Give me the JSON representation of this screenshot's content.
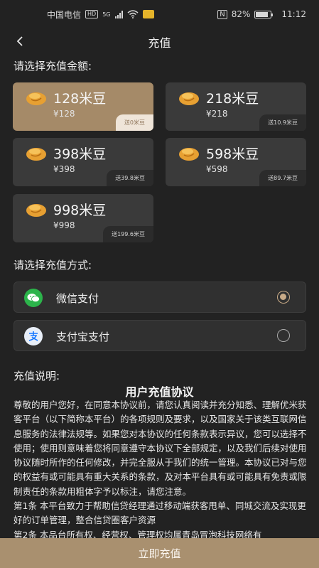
{
  "status_bar": {
    "carrier": "中国电信",
    "hd": "HD",
    "network": "5G",
    "nfc": "N",
    "battery": "82%",
    "time": "11:12"
  },
  "header": {
    "title": "充值",
    "back_icon": "chevron-left-icon"
  },
  "amount_section": {
    "label": "请选择充值金额:",
    "options": [
      {
        "title": "128米豆",
        "price": "¥128",
        "bonus": "送0米豆",
        "selected": true
      },
      {
        "title": "218米豆",
        "price": "¥218",
        "bonus": "送10.9米豆",
        "selected": false
      },
      {
        "title": "398米豆",
        "price": "¥398",
        "bonus": "送39.8米豆",
        "selected": false
      },
      {
        "title": "598米豆",
        "price": "¥598",
        "bonus": "送89.7米豆",
        "selected": false
      },
      {
        "title": "998米豆",
        "price": "¥998",
        "bonus": "送199.6米豆",
        "selected": false
      }
    ]
  },
  "payment_section": {
    "label": "请选择充值方式:",
    "methods": [
      {
        "label": "微信支付",
        "icon": "wechat-icon",
        "selected": true
      },
      {
        "label": "支付宝支付",
        "icon": "alipay-icon",
        "selected": false
      }
    ]
  },
  "description": {
    "label": "充值说明:",
    "agreement_title": "用户充值协议",
    "paragraphs": [
      "尊敬的用户您好，在同意本协议前，请您认真阅读并充分知悉、理解优米获客平台（以下简称本平台）的各项规则及要求，以及国家关于该类互联网信息服务的法律法规等。如果您对本协议的任何条款表示异议，您可以选择不使用；使用则意味着您将同意遵守本协议下全部规定，以及我们后续对使用协议随时所作的任何修改，并完全服从于我们的统一管理。本协议已对与您的权益有或可能具有重大关系的条款，及对本平台具有或可能具有免责或限制责任的条款用粗体字予以标注，请您注意。",
      "第1条 本平台致力于帮助信贷经理通过移动端获客甩单、同城交流及实现更好的订单管理，整合信贷圈客户资源",
      "第2条 本品台所有权、经营权、管理权均属青岛冒泡科技网络有"
    ]
  },
  "submit": {
    "label": "立即充值"
  },
  "colors": {
    "background": "#222222",
    "card": "#3a3a3a",
    "selected_card": "#a58a68",
    "accent": "#c9ab87",
    "submit_bar": "#a9906f"
  }
}
